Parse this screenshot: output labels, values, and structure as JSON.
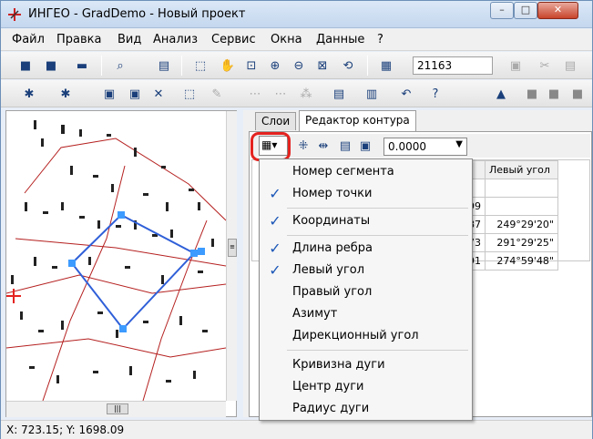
{
  "window": {
    "title": "ИНГЕО - GradDemo - Новый проект",
    "buttons": {
      "min": "–",
      "max": "□",
      "close": "✕"
    }
  },
  "menubar": [
    "Файл",
    "Правка",
    "Вид",
    "Анализ",
    "Сервис",
    "Окна",
    "Данные",
    "?"
  ],
  "toolbar": {
    "layer_value": "21163"
  },
  "tabs": [
    "Слои",
    "Редактор контура"
  ],
  "panel": {
    "value_select": "0.0000",
    "grid": {
      "headers": [
        "а",
        "Левый угол"
      ],
      "rows": [
        [
          "",
          ""
        ],
        [
          "2099",
          ""
        ],
        [
          "3987",
          "249°29'20\""
        ],
        [
          "3173",
          "291°29'25\""
        ],
        [
          "4291",
          "274°59'48\""
        ]
      ]
    }
  },
  "dropdown_menu": [
    {
      "label": "Номер сегмента",
      "checked": false
    },
    {
      "label": "Номер точки",
      "checked": true
    },
    {
      "label": "Координаты",
      "checked": true
    },
    {
      "label": "Длина ребра",
      "checked": true
    },
    {
      "label": "Левый угол",
      "checked": true
    },
    {
      "label": "Правый угол",
      "checked": false
    },
    {
      "label": "Азимут",
      "checked": false
    },
    {
      "label": "Дирекционный угол",
      "checked": false
    },
    {
      "label": "Кривизна дуги",
      "checked": false
    },
    {
      "label": "Центр дуги",
      "checked": false
    },
    {
      "label": "Радиус дуги",
      "checked": false
    }
  ],
  "statusbar": {
    "coords": "X: 723.15; Y: 1698.09"
  },
  "icons": {
    "check": "✓"
  },
  "colors": {
    "highlight": "#e4231f",
    "polygon": "#2f5fd8",
    "vertex": "#3d9bff"
  }
}
